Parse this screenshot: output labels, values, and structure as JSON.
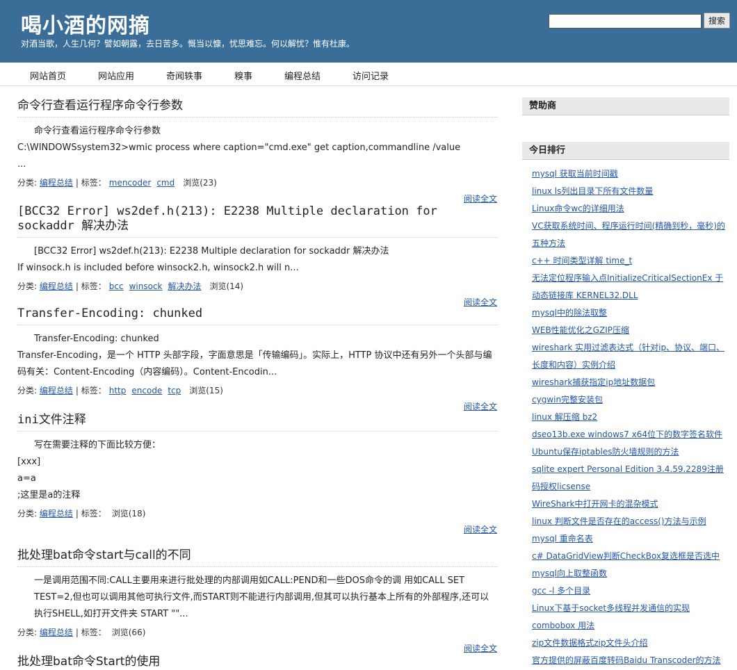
{
  "header": {
    "title": "喝小酒的网摘",
    "subtitle": "对酒当歌，人生几何？譬如朝露，去日苦多。慨当以慷，忧思难忘。何以解忧？惟有杜康。",
    "search_placeholder": "",
    "search_button": "搜索"
  },
  "nav": [
    "网站首页",
    "网站应用",
    "奇闻轶事",
    "糗事",
    "编程总结",
    "访问记录"
  ],
  "meta_labels": {
    "category": "分类:",
    "tags": "| 标签：",
    "more": "阅读全文"
  },
  "posts": [
    {
      "title": "命令行查看运行程序命令行参数",
      "lines": [
        "命令行查看运行程序命令行参数",
        "C:\\WINDOWSsystem32>wmic process where caption=\"cmd.exe\" get caption,commandline /value",
        "..."
      ],
      "category": "编程总结",
      "tags": [
        "mencoder",
        "cmd"
      ],
      "views": "浏览(23)"
    },
    {
      "title": "[BCC32 Error] ws2def.h(213): E2238 Multiple declaration for sockaddr 解决办法",
      "lines": [
        "[BCC32 Error] ws2def.h(213): E2238 Multiple declaration for sockaddr 解决办法",
        "If winsock.h is included before winsock2.h, winsock2.h will n..."
      ],
      "category": "编程总结",
      "tags": [
        "bcc",
        "winsock",
        "解决办法"
      ],
      "views": "浏览(14)"
    },
    {
      "title": "Transfer-Encoding: chunked",
      "lines": [
        "Transfer-Encoding: chunked",
        "Transfer-Encoding，是一个 HTTP 头部字段，字面意思是「传输编码」。实际上，HTTP 协议中还有另外一个头部与编码有关：Content-Encoding（内容编码）。Content-Encodin..."
      ],
      "category": "编程总结",
      "tags": [
        "http",
        "encode",
        "tcp"
      ],
      "views": "浏览(15)"
    },
    {
      "title": "ini文件注释",
      "lines": [
        "写在需要注释的下面比较方便：",
        "[xxx]",
        "a=a",
        ";这里是a的注释"
      ],
      "category": "编程总结",
      "tags": [],
      "views": "浏览(18)"
    },
    {
      "title": "批处理bat命令start与call的不同",
      "lines": [
        "一是调用范围不同:CALL主要用来进行批处理的内部调用如CALL:PEND和一些DOS命令的调 用如CALL SET TEST=2,但也可以调用其他可执行文件,而START则不能进行内部调用,但其可以执行基本上所有的外部程序,还可以执行SHELL,如打开文件夹 START \"\"..."
      ],
      "category": "编程总结",
      "tags": [],
      "views": "浏览(66)"
    },
    {
      "title": "批处理bat命令Start的使用",
      "lines": [],
      "category": "",
      "tags": [],
      "views": ""
    }
  ],
  "sidebar": {
    "sponsor_title": "赞助商",
    "today_title": "今日排行",
    "today_items": [
      "mysql 获取当前时间戳",
      "linux ls列出目录下所有文件数量",
      "Linux命令wc的详细用法",
      "VC获取系统时间、程序运行时间(精确到秒，毫秒)的五种方法",
      "c++ 时间类型详解 time_t",
      "无法定位程序输入点InitializeCriticalSectionEx 于动态链接库 KERNEL32.DLL",
      "mysql中的除法取整",
      "WEB性能优化之GZIP压缩",
      "wireshark 实用过滤表达式（针对ip、协议、端口、长度和内容）实例介绍",
      "wireshark捕获指定ip地址数据包",
      "cygwin完整安装包",
      "linux 解压缩 bz2",
      "dseo13b.exe windows7 x64位下的数字签名软件",
      "Ubuntu保存iptables防火墙规则的方法",
      "sqlite expert Personal Edition 3.4.59.2289注册码授权licsense",
      "WireShark中打开网卡的混杂模式",
      "linux 判断文件是否存在的access()方法与示例",
      "mysql 重命名表",
      "c# DataGridView判断CheckBox复选框是否选中",
      "mysql向上取整函数",
      "gcc -l 多个目录",
      "Linux下基于socket多线程并发通信的实现",
      "combobox 用法",
      "zip文件数据格式zip文件头介绍",
      "官方提供的屏蔽百度转码Baidu Transcoder的方法"
    ]
  }
}
